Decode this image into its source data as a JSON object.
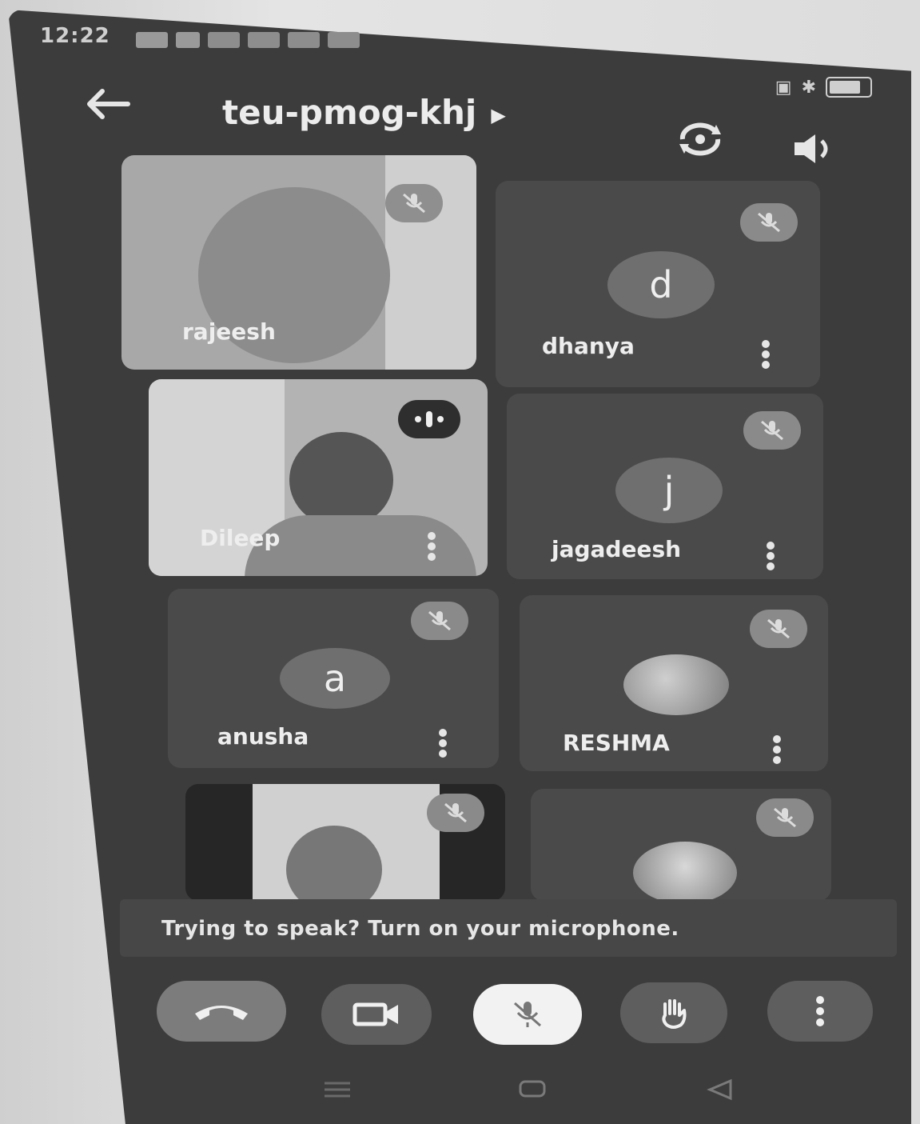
{
  "status_bar": {
    "time": "12:22"
  },
  "header": {
    "meeting_code": "teu-pmog-khj"
  },
  "participants": [
    {
      "name": "rajeesh"
    },
    {
      "name": "dhanya",
      "initial": "d"
    },
    {
      "name": "Dileep"
    },
    {
      "name": "jagadeesh",
      "initial": "j"
    },
    {
      "name": "anusha",
      "initial": "a"
    },
    {
      "name": "RESHMA"
    }
  ],
  "banner": {
    "text": "Trying to speak? Turn on your microphone."
  },
  "icons": {
    "back": "arrow-left-icon",
    "switch_camera": "switch-camera-icon",
    "speaker": "speaker-icon",
    "mic_off": "mic-off-icon",
    "speaking": "speaking-indicator-icon",
    "more": "more-vertical-icon",
    "end_call": "end-call-icon",
    "camera": "video-camera-icon",
    "raise_hand": "raise-hand-icon"
  },
  "colors": {
    "screen_bg": "#3c3c3c",
    "tile_bg": "#4a4a4a",
    "badge_bg": "#8a8a8a"
  }
}
